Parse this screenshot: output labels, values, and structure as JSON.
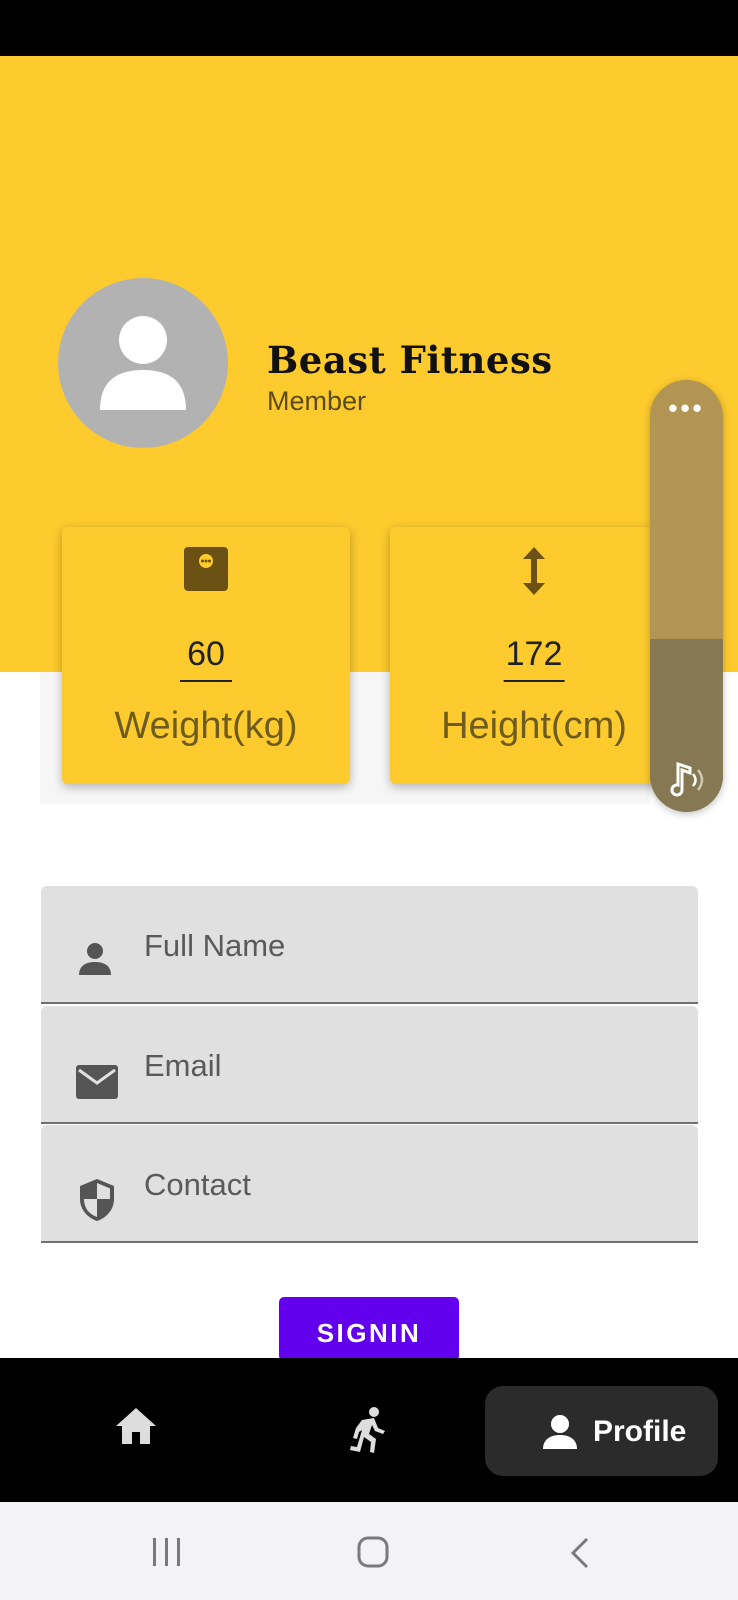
{
  "colors": {
    "header_yellow": "#fdcb2e",
    "accent_purple": "#6200ee",
    "nav_black": "#000000",
    "field_gray": "#e0e0e0"
  },
  "profile": {
    "name": "Beast Fitness",
    "role": "Member",
    "avatar_icon": "person-icon"
  },
  "stats": {
    "weight": {
      "icon": "scale-icon",
      "value": "60",
      "label": "Weight(kg)"
    },
    "height": {
      "icon": "vertical-arrows-icon",
      "value": "172",
      "label": "Height(cm)"
    }
  },
  "volume_panel": {
    "menu_icon": "more-dots-icon",
    "icon": "music-volume-icon",
    "level_fraction": 0.4
  },
  "form": {
    "fields": [
      {
        "icon": "person-icon",
        "placeholder": "Full Name"
      },
      {
        "icon": "mail-icon",
        "placeholder": "Email"
      },
      {
        "icon": "shield-icon",
        "placeholder": "Contact"
      }
    ],
    "submit_label": "SIGNIN"
  },
  "bottom_nav": {
    "items": [
      {
        "icon": "home-icon",
        "label": ""
      },
      {
        "icon": "running-icon",
        "label": ""
      },
      {
        "icon": "person-icon",
        "label": "Profile",
        "selected": true
      }
    ]
  },
  "system_nav": {
    "items": [
      "recents-icon",
      "home-circle-icon",
      "back-icon"
    ]
  }
}
